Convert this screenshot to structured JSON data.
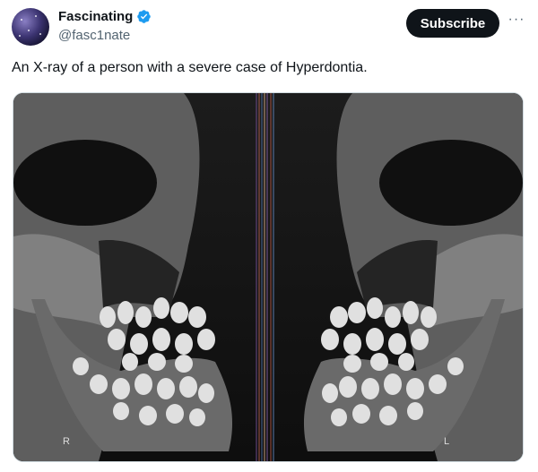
{
  "author": {
    "display_name": "Fascinating",
    "handle": "@fasc1nate",
    "verified_icon": "verified-badge-icon",
    "avatar_icon": "galaxy-avatar"
  },
  "actions": {
    "subscribe_label": "Subscribe",
    "more_icon": "more-horizontal-icon"
  },
  "tweet": {
    "text": "An X-ray of a person with a severe case of Hyperdontia."
  },
  "media": {
    "description_icon": "xray-skull-image",
    "left_marker": "R",
    "right_marker": "L"
  },
  "colors": {
    "accent": "#1d9bf0",
    "button_bg": "#0f1419",
    "handle": "#536471"
  }
}
